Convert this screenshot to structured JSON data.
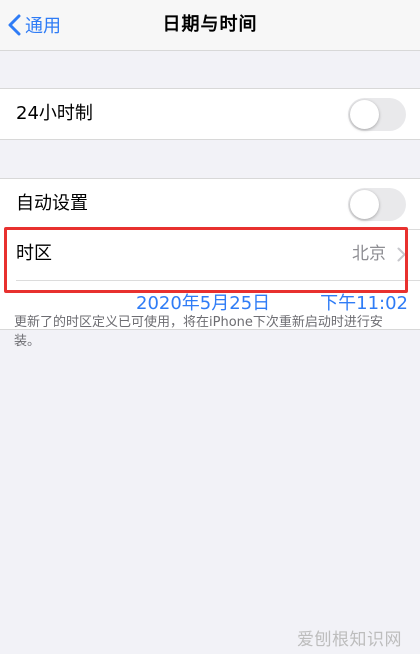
{
  "navbar": {
    "back_label": "通用",
    "title": "日期与时间"
  },
  "settings": {
    "hour24": {
      "label": "24小时制",
      "toggle_on": false
    },
    "auto_set": {
      "label": "自动设置",
      "toggle_on": false
    },
    "timezone": {
      "label": "时区",
      "value": "北京"
    },
    "date": "2020年5月25日",
    "time": "下午11:02"
  },
  "footnote": "更新了的时区定义已可使用，将在iPhone下次重新启动时进行安装。",
  "watermark": "爱刨根知识网",
  "colors": {
    "accent": "#2f7cf6",
    "highlight": "#e8312f",
    "background": "#f2f2f7"
  }
}
